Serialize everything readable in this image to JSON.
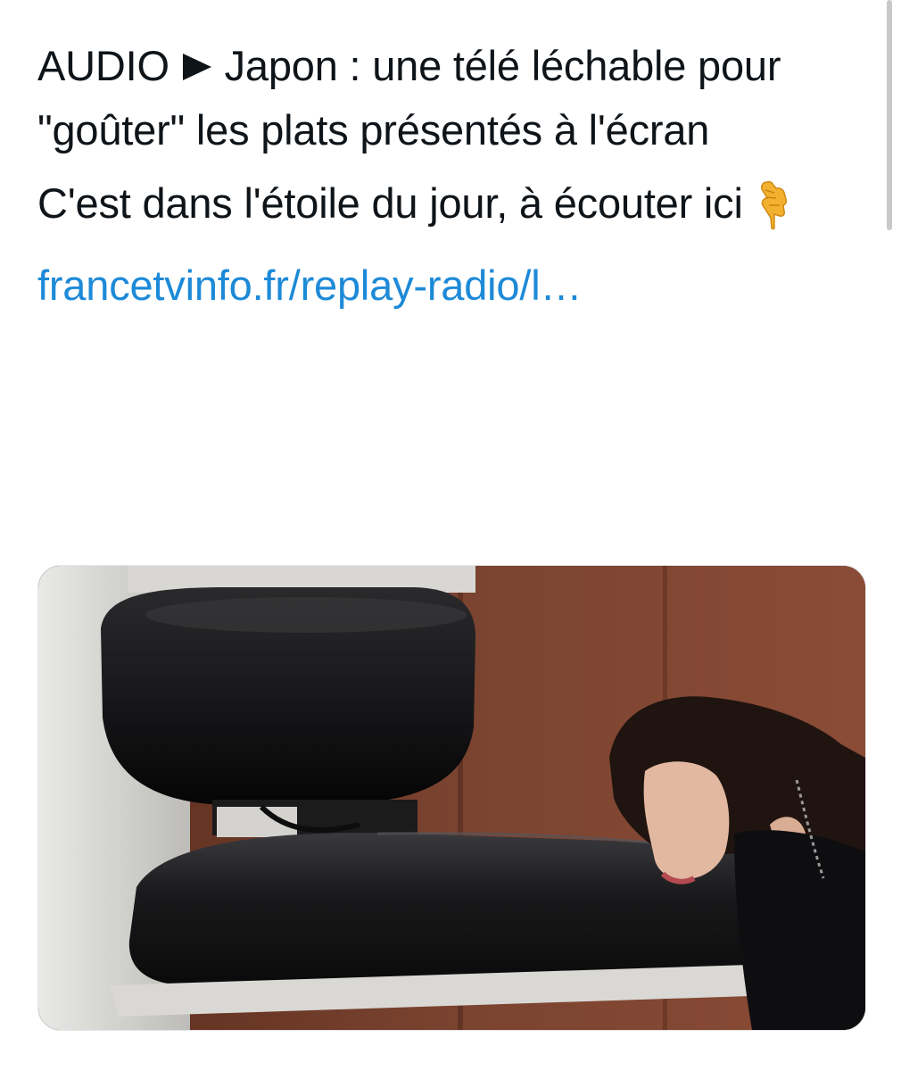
{
  "tweet": {
    "paragraph1": {
      "before_icon": "AUDIO",
      "icon": "play-triangle-icon",
      "after_icon": "Japon : une télé léchable pour \"goûter\" les plats présentés à l'écran"
    },
    "paragraph2": {
      "text": "C'est dans l'étoile du jour, à écouter ici",
      "emoji": "👇"
    },
    "link": "francetvinfo.fr/replay-radio/l…"
  },
  "media": {
    "icon": "photo-woman-licking-tv-screen"
  },
  "colors": {
    "text": "#0f1419",
    "link": "#1d8ad8"
  }
}
